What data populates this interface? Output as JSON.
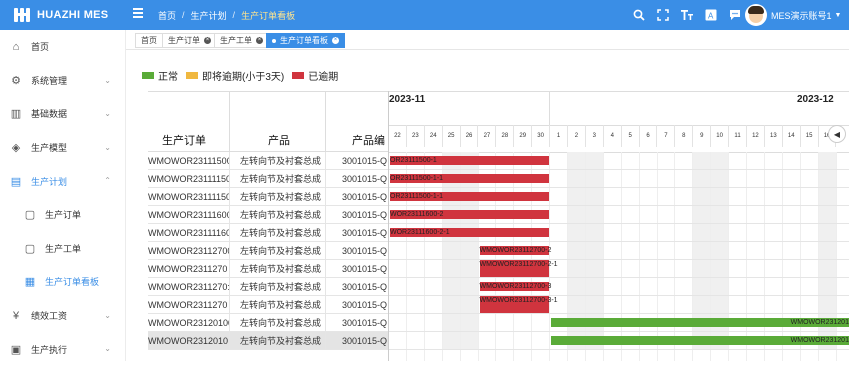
{
  "app": {
    "logo_text": "HUAZHI MES"
  },
  "breadcrumb": [
    "首页",
    "生产计划",
    "生产订单看板"
  ],
  "user": {
    "name": "MES演示账号1"
  },
  "top_icons": [
    "search-icon",
    "fullscreen-icon",
    "font-size-icon",
    "translate-icon",
    "message-icon"
  ],
  "sidebar": {
    "items": [
      {
        "label": "首页",
        "icon": "home-icon"
      },
      {
        "label": "系统管理",
        "icon": "gear-icon"
      },
      {
        "label": "基础数据",
        "icon": "chart-icon"
      },
      {
        "label": "生产模型",
        "icon": "cube-icon"
      },
      {
        "label": "生产计划",
        "icon": "clipboard-icon"
      },
      {
        "label": "生产订单",
        "icon": "doc-icon"
      },
      {
        "label": "生产工单",
        "icon": "doc-icon"
      },
      {
        "label": "生产订单看板",
        "icon": "board-icon"
      },
      {
        "label": "绩效工资",
        "icon": "yen-icon"
      },
      {
        "label": "生产执行",
        "icon": "doc-icon"
      }
    ]
  },
  "tabs": [
    "首页",
    "生产订单",
    "生产工单",
    "生产订单看板"
  ],
  "legend": [
    {
      "label": "正常",
      "color": "#5aab38"
    },
    {
      "label": "即将逾期(小于3天)",
      "color": "#f0b840"
    },
    {
      "label": "已逾期",
      "color": "#d0343e"
    }
  ],
  "table": {
    "headers": [
      "生产订单",
      "产品",
      "产品编"
    ],
    "rows": [
      [
        "WMOWOR23111500",
        "左转向节及衬套总成",
        "3001015-Q"
      ],
      [
        "WMOWOR23111150",
        "左转向节及衬套总成",
        "3001015-Q"
      ],
      [
        "WMOWOR23111150",
        "左转向节及衬套总成",
        "3001015-Q"
      ],
      [
        "WMOWOR23111600:",
        "左转向节及衬套总成",
        "3001015-Q"
      ],
      [
        "WMOWOR23111160",
        "左转向节及衬套总成",
        "3001015-Q"
      ],
      [
        "WMOWOR23112700:",
        "左转向节及衬套总成",
        "3001015-Q"
      ],
      [
        "WMOWOR2311270",
        "左转向节及衬套总成",
        "3001015-Q"
      ],
      [
        "WMOWOR2311270:",
        "左转向节及衬套总成",
        "3001015-Q"
      ],
      [
        "WMOWOR2311270",
        "左转向节及衬套总成",
        "3001015-Q"
      ],
      [
        "WMOWOR23120100",
        "左转向节及衬套总成",
        "3001015-Q"
      ],
      [
        "WMOWOR2312010",
        "左转向节及衬套总成",
        "3001015-Q"
      ]
    ]
  },
  "gantt": {
    "months": [
      "2023-11",
      "2023-12"
    ],
    "days": [
      "22",
      "23",
      "24",
      "25",
      "26",
      "27",
      "28",
      "29",
      "30",
      "1",
      "2",
      "3",
      "4",
      "5",
      "6",
      "7",
      "8",
      "9",
      "10",
      "11",
      "12",
      "13",
      "14",
      "15",
      "16"
    ],
    "shaded_days": [
      "25",
      "26",
      "2",
      "3",
      "9",
      "10",
      "16"
    ],
    "bars": [
      {
        "row": 0,
        "start": 0,
        "end": 8,
        "color": "red",
        "label": "OR23111500-1"
      },
      {
        "row": 1,
        "start": 0,
        "end": 8,
        "color": "red",
        "label": "OR23111500-1-1"
      },
      {
        "row": 2,
        "start": 0,
        "end": 8,
        "color": "red",
        "label": "OR23111500-1-1"
      },
      {
        "row": 3,
        "start": 0,
        "end": 8,
        "color": "red",
        "label": "WOR23111600-2"
      },
      {
        "row": 4,
        "start": 0,
        "end": 8,
        "color": "red",
        "label": "WOR23111600-2-1"
      },
      {
        "row": 5,
        "start": 5,
        "end": 8,
        "color": "red",
        "label": "WMOWOR23112700-2"
      },
      {
        "row": 6,
        "start": 5,
        "end": 8,
        "color": "red",
        "label": "WMOWOR23112700-2-1",
        "tall": true
      },
      {
        "row": 7,
        "start": 5,
        "end": 8,
        "color": "red",
        "label": "WMOWOR23112700-3"
      },
      {
        "row": 8,
        "start": 5,
        "end": 8,
        "color": "red",
        "label": "WMOWOR23112700-3-1",
        "tall": true
      },
      {
        "row": 9,
        "start": 9,
        "end": 25,
        "color": "green",
        "label": "WMOWOR231201"
      },
      {
        "row": 10,
        "start": 9,
        "end": 25,
        "color": "green",
        "label": "WMOWOR231201"
      }
    ]
  }
}
